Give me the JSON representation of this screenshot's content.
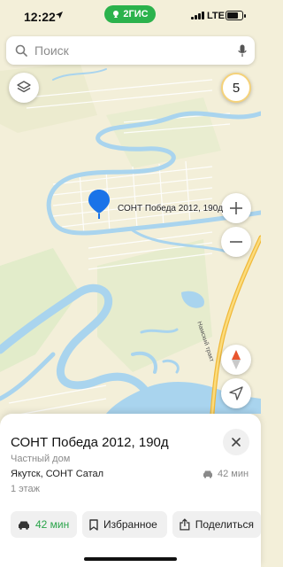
{
  "status_bar": {
    "time": "12:22",
    "app_badge": "2ГИС",
    "network": "LTE",
    "battery_percent": 75
  },
  "search": {
    "placeholder": "Поиск",
    "icon": "search-icon",
    "mic_icon": "microphone-icon"
  },
  "map": {
    "zoom_level": "5",
    "pin_label": "СОНТ Победа 2012, 190д",
    "road_label": "Намский тракт",
    "colors": {
      "land": "#f3efd9",
      "water": "#a9d4ee",
      "pin": "#1a73e8",
      "road": "#f0b838",
      "green": "#d6e8c4"
    }
  },
  "place_card": {
    "title": "СОНТ Победа 2012, 190д",
    "category": "Частный дом",
    "address": "Якутск, СОНТ Сатал",
    "floors": "1 этаж",
    "drive_time": "42 мин"
  },
  "actions": {
    "route_label": "42 мин",
    "favorites_label": "Избранное",
    "share_label": "Поделиться"
  }
}
